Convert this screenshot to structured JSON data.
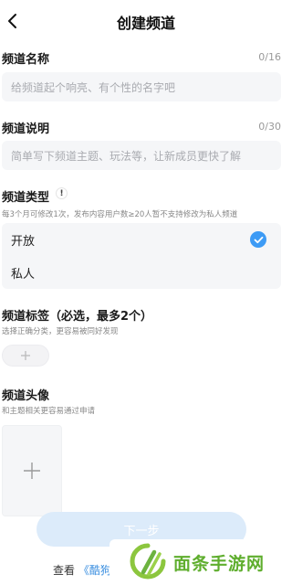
{
  "header": {
    "title": "创建频道",
    "back_icon": "chevron-left-icon"
  },
  "name_section": {
    "label": "频道名称",
    "counter": "0/16",
    "placeholder": "给频道起个响亮、有个性的名字吧"
  },
  "desc_section": {
    "label": "频道说明",
    "counter": "0/30",
    "placeholder": "简单写下频道主题、玩法等，让新成员更快了解"
  },
  "type_section": {
    "label": "频道类型",
    "info_glyph": "!",
    "hint": "每3个月可修改1次，发布内容用户数≥20人暂不支持修改为私人频道",
    "options": [
      {
        "label": "开放",
        "selected": true
      },
      {
        "label": "私人",
        "selected": false
      }
    ],
    "accent": "#3d9bf5"
  },
  "tag_section": {
    "label": "频道标签（必选，最多2个）",
    "hint": "选择正确分类，更容易被同好发现",
    "add_icon": "plus-icon"
  },
  "avatar_section": {
    "label": "频道头像",
    "hint": "和主题相关更容易通过申请",
    "add_icon": "plus-icon"
  },
  "next_button": {
    "label": "下一步"
  },
  "footer": {
    "prefix": "查看",
    "link": "《酷狗"
  },
  "watermark": {
    "text": "面条手游网",
    "color": "#5fae2e"
  }
}
